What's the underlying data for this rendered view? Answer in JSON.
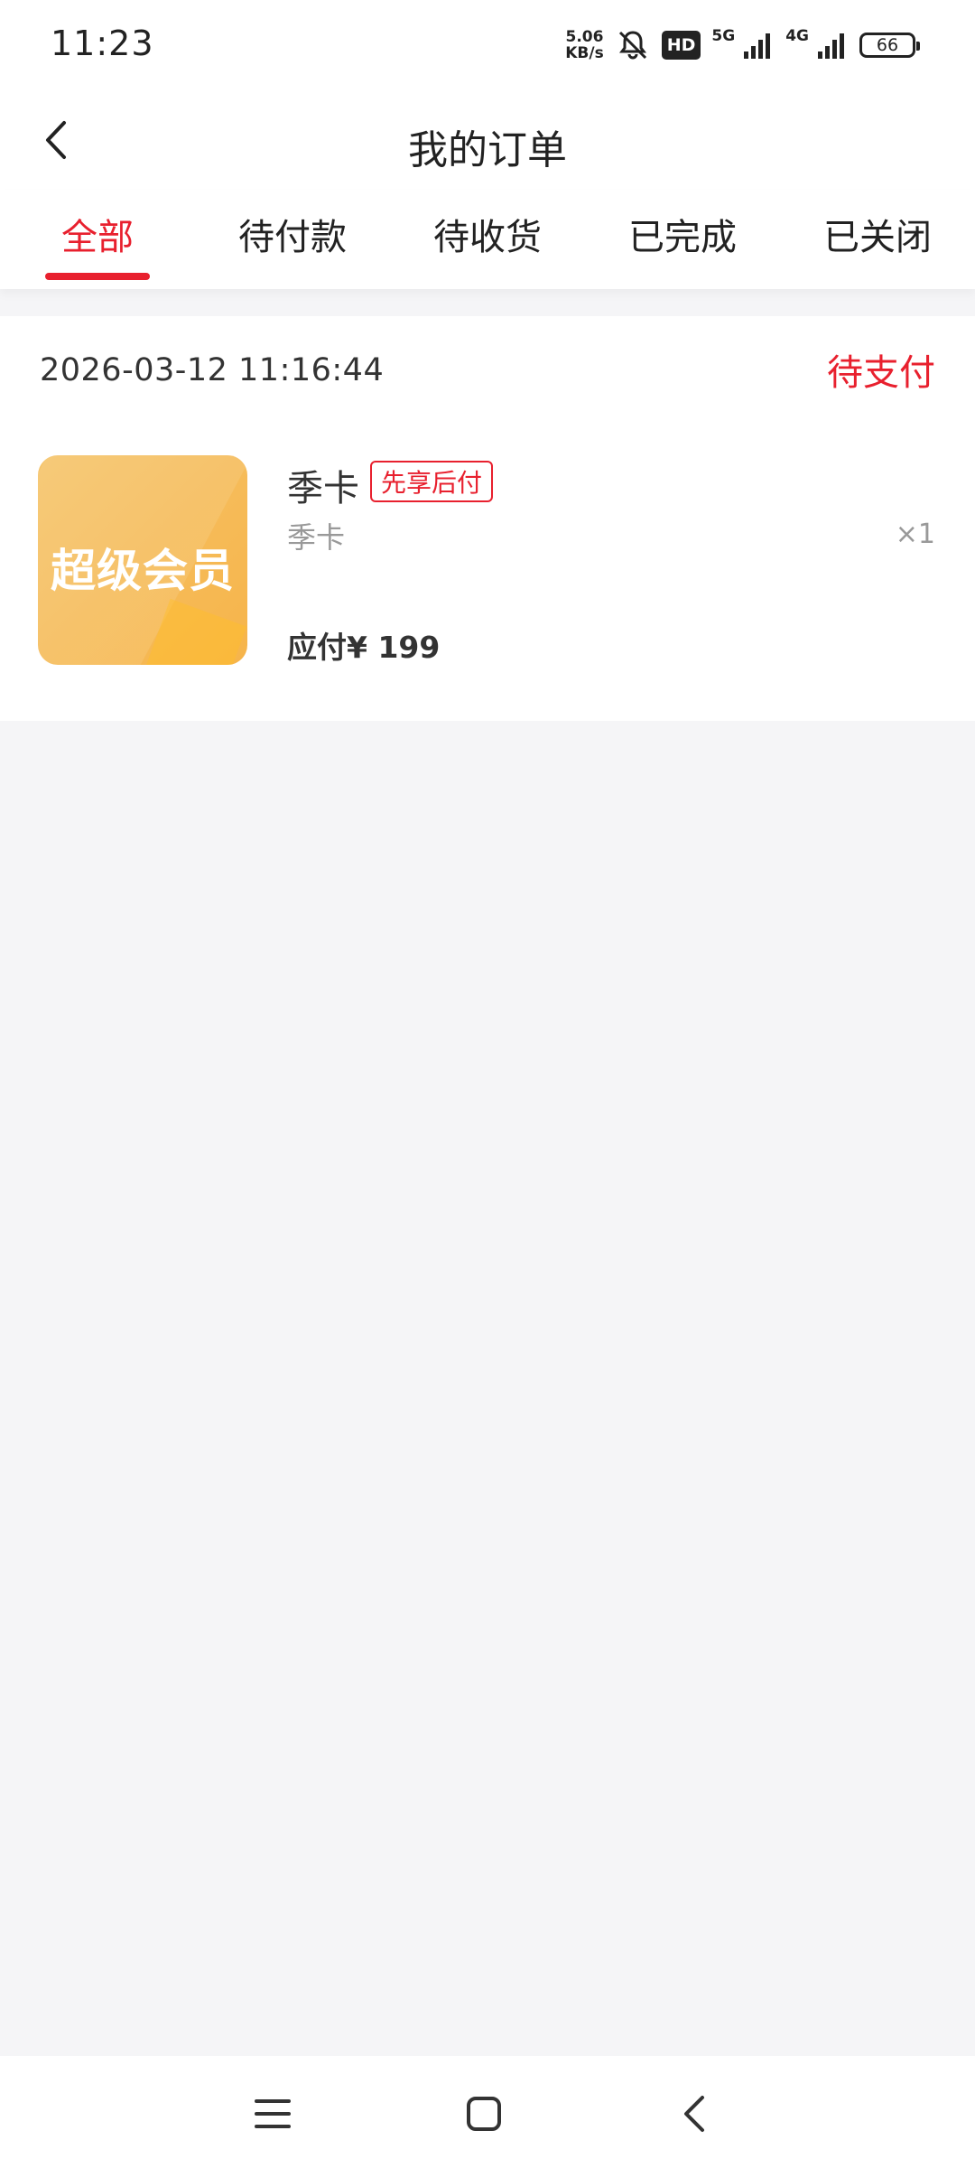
{
  "status_bar": {
    "time": "11:23",
    "net_speed_value": "5.06",
    "net_speed_unit": "KB/s",
    "hd_label": "HD",
    "sim1_label": "5G",
    "sim2_label": "4G",
    "battery_level": "66"
  },
  "header": {
    "title": "我的订单"
  },
  "tabs": [
    {
      "label": "全部",
      "active": true
    },
    {
      "label": "待付款",
      "active": false
    },
    {
      "label": "待收货",
      "active": false
    },
    {
      "label": "已完成",
      "active": false
    },
    {
      "label": "已关闭",
      "active": false
    }
  ],
  "orders": [
    {
      "date": "2026-03-12 11:16:44",
      "status": "待支付",
      "image_text": "超级会员",
      "product_name": "季卡",
      "tag": "先享后付",
      "spec": "季卡",
      "quantity": "×1",
      "amount_label": "应付¥ 199"
    }
  ],
  "colors": {
    "accent": "#e8202e",
    "background": "#f5f5f7",
    "card": "#ffffff",
    "product_image": "#f6b44a"
  },
  "icons": {
    "back": "chevron-left-icon",
    "mute": "bell-muted-icon",
    "nav_menu": "menu-icon",
    "nav_home": "home-square-icon",
    "nav_back": "back-icon"
  }
}
